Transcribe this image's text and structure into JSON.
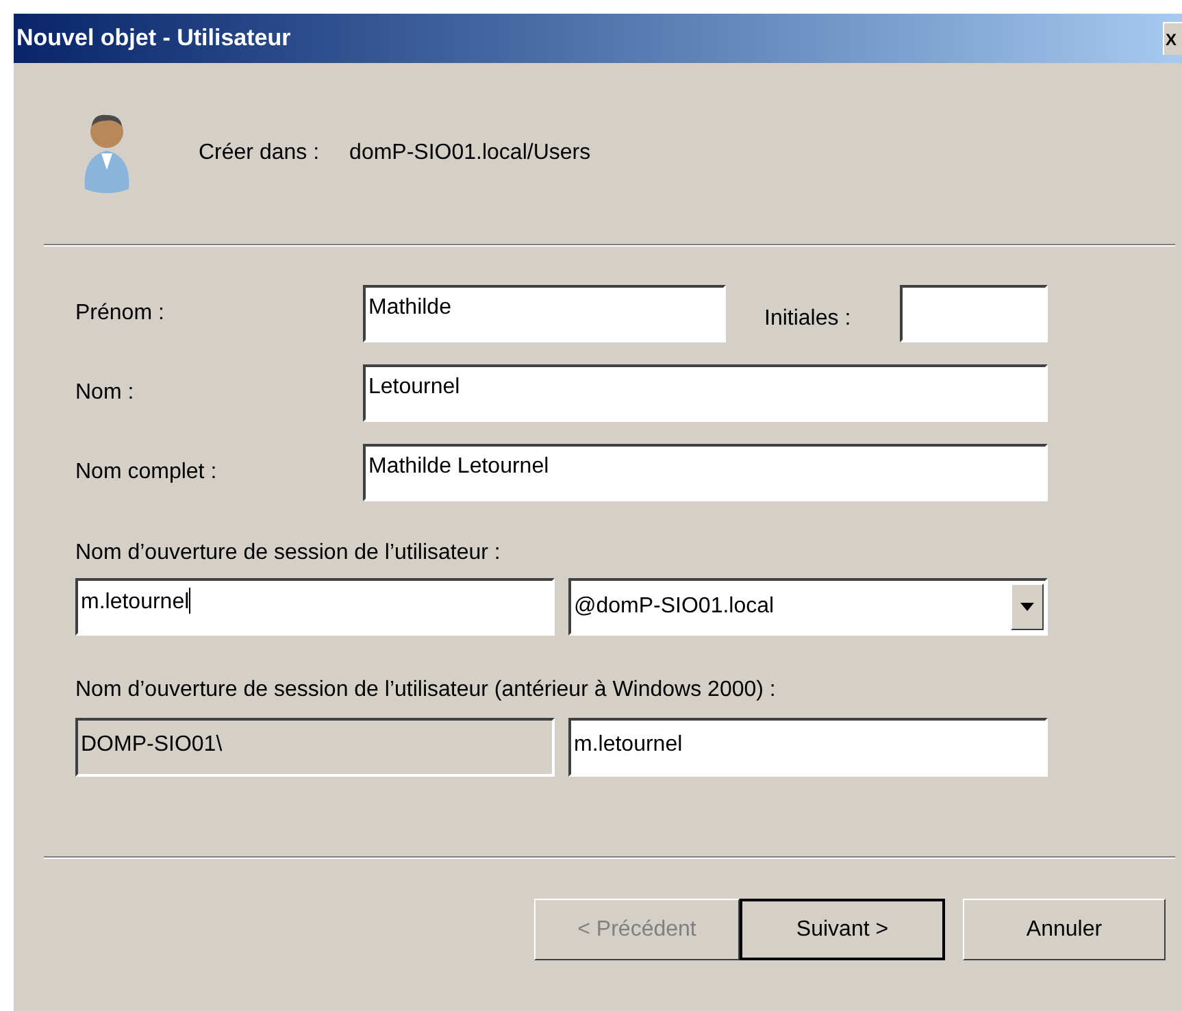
{
  "window": {
    "title": "Nouvel objet - Utilisateur",
    "close": "X"
  },
  "location": {
    "label": "Créer dans :",
    "value": "domP-SIO01.local/Users"
  },
  "name_rows": [
    {
      "label": "Prénom :",
      "value": "Mathilde",
      "extra_label": "Initiales :",
      "extra_value": ""
    },
    {
      "label": "Nom :",
      "value": "Letournel"
    },
    {
      "label": "Nom complet :",
      "value": "Mathilde Letournel"
    }
  ],
  "logon": {
    "label": "Nom d’ouverture de session de l’utilisateur :",
    "value": "m.letournel",
    "domain": "@domP-SIO01.local",
    "focused": true
  },
  "legacy_logon": {
    "label": "Nom d’ouverture de session de l’utilisateur (antérieur à Windows 2000) :",
    "prefix": "DOMP-SIO01\\",
    "prefix_disabled": true,
    "value": "m.letournel"
  },
  "buttons": [
    {
      "label": "< Précédent",
      "disabled": true,
      "default": false
    },
    {
      "label": "Suivant >",
      "disabled": false,
      "default": true
    },
    {
      "label": "Annuler",
      "disabled": false,
      "default": false
    }
  ]
}
